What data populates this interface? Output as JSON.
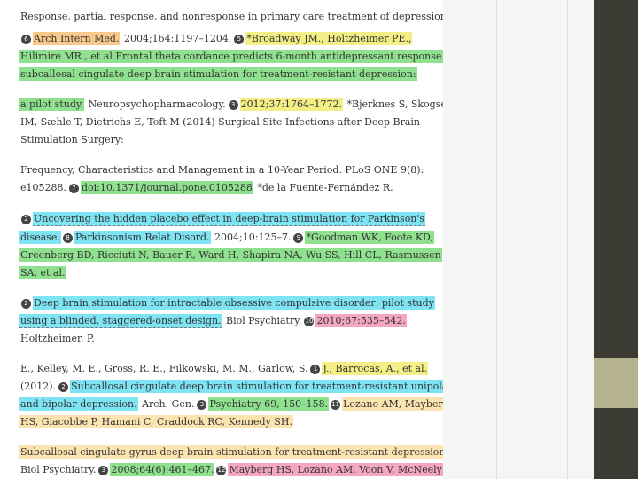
{
  "lines": [
    [
      {
        "t": "Response, partial response, and nonresponse in primary care treatment of depression.",
        "c": ""
      },
      {
        "t": "|",
        "c": "hl-orange"
      }
    ],
    [
      {
        "badge": "6"
      },
      {
        "t": "Arch Intern Med.",
        "c": "hl-orange"
      },
      {
        "t": " 2004;164:1197–1204.",
        "c": ""
      },
      {
        "badge": "5"
      },
      {
        "t": "*Broadway JM., Holtzheimer PE.,",
        "c": "hl-yellow"
      }
    ],
    [
      {
        "t": "Hilimire MR., et al Frontal theta cordance predicts 6-month antidepressant response to",
        "c": "hl-green"
      }
    ],
    [
      {
        "t": "subcallosal cingulate deep brain stimulation for treatment-resistant depression:",
        "c": "hl-green"
      }
    ],
    [
      {
        "t": "a pilot study.",
        "c": "hl-green"
      },
      {
        "t": " Neuropsychopharmacology.",
        "c": ""
      },
      {
        "badge": "3"
      },
      {
        "t": "2012;37:1764–1772.",
        "c": "hl-yellow"
      },
      {
        "t": " *Bjerknes S, Skogseid",
        "c": ""
      }
    ],
    [
      {
        "t": "IM, Sæhle T, Dietrichs E, Toft M (2014) Surgical Site Infections after Deep Brain",
        "c": ""
      }
    ],
    [
      {
        "t": "Stimulation Surgery:",
        "c": ""
      }
    ],
    [
      {
        "t": "Frequency, Characteristics and Management in a 10-Year Period. PLoS ONE 9(8):",
        "c": ""
      }
    ],
    [
      {
        "t": "e105288.",
        "c": ""
      },
      {
        "badge": "7"
      },
      {
        "t": "doi:10.1371/journal.pone.0105288",
        "c": "hl-green"
      },
      {
        "t": " *de la Fuente-Fernández R.",
        "c": ""
      }
    ],
    [
      {
        "badge": "2"
      },
      {
        "t": "Uncovering the hidden placebo effect in deep-brain stimulation for Parkinson's",
        "c": "hl-cyan ul"
      }
    ],
    [
      {
        "t": "disease.",
        "c": "hl-cyan"
      },
      {
        "badge": "8"
      },
      {
        "t": "Parkinsonism Relat Disord.",
        "c": "hl-cyan"
      },
      {
        "t": " 2004;10:125–7.",
        "c": ""
      },
      {
        "badge": "9"
      },
      {
        "t": "*Goodman WK, Foote KD,",
        "c": "hl-green"
      }
    ],
    [
      {
        "t": "Greenberg BD, Ricciuti N, Bauer R, Ward H, Shapira NA, Wu SS, Hill CL, Rasmussen",
        "c": "hl-green"
      }
    ],
    [
      {
        "t": "SA, et al.",
        "c": "hl-green"
      }
    ],
    [
      {
        "badge": "2"
      },
      {
        "t": "Deep brain stimulation for intractable obsessive compulsive disorder: pilot study",
        "c": "hl-cyan ul"
      }
    ],
    [
      {
        "t": "using a blinded, staggered-onset design.",
        "c": "hl-cyan ul"
      },
      {
        "t": " Biol Psychiatry.",
        "c": ""
      },
      {
        "badge": "10"
      },
      {
        "t": "2010;67:535–542.",
        "c": "hl-pink"
      }
    ],
    [
      {
        "t": "Holtzheimer, P.",
        "c": ""
      }
    ],
    [
      {
        "t": "E., Kelley, M. E., Gross, R. E., Filkowski, M. M., Garlow, S.",
        "c": ""
      },
      {
        "badge": "1"
      },
      {
        "t": "J., Barrocas, A., et al.",
        "c": "hl-yellow"
      }
    ],
    [
      {
        "t": "(2012).",
        "c": ""
      },
      {
        "badge": "2"
      },
      {
        "t": "Subcallosal cingulate deep brain stimulation for treatment-resistant unipolar",
        "c": "hl-cyan"
      }
    ],
    [
      {
        "t": "and bipolar depression.",
        "c": "hl-cyan"
      },
      {
        "t": " Arch. Gen.",
        "c": ""
      },
      {
        "badge": "3"
      },
      {
        "t": "Psychiatry 69, 150–158.",
        "c": "hl-green"
      },
      {
        "badge": "11"
      },
      {
        "t": "Lozano AM, Mayberg",
        "c": "hl-peach"
      }
    ],
    [
      {
        "t": "HS, Giacobbe P, Hamani C, Craddock RC, Kennedy SH.",
        "c": "hl-peach"
      }
    ],
    [
      {
        "t": "Subcallosal cingulate gyrus deep brain stimulation for treatment-resistant depression.",
        "c": "hl-peach"
      }
    ],
    [
      {
        "t": "Biol Psychiatry.",
        "c": ""
      },
      {
        "badge": "3"
      },
      {
        "t": "2008;64(6):461–467.",
        "c": "hl-green"
      },
      {
        "badge": "12"
      },
      {
        "t": "Mayberg HS, Lozano AM, Voon V, McNeely",
        "c": "hl-pink"
      }
    ]
  ]
}
